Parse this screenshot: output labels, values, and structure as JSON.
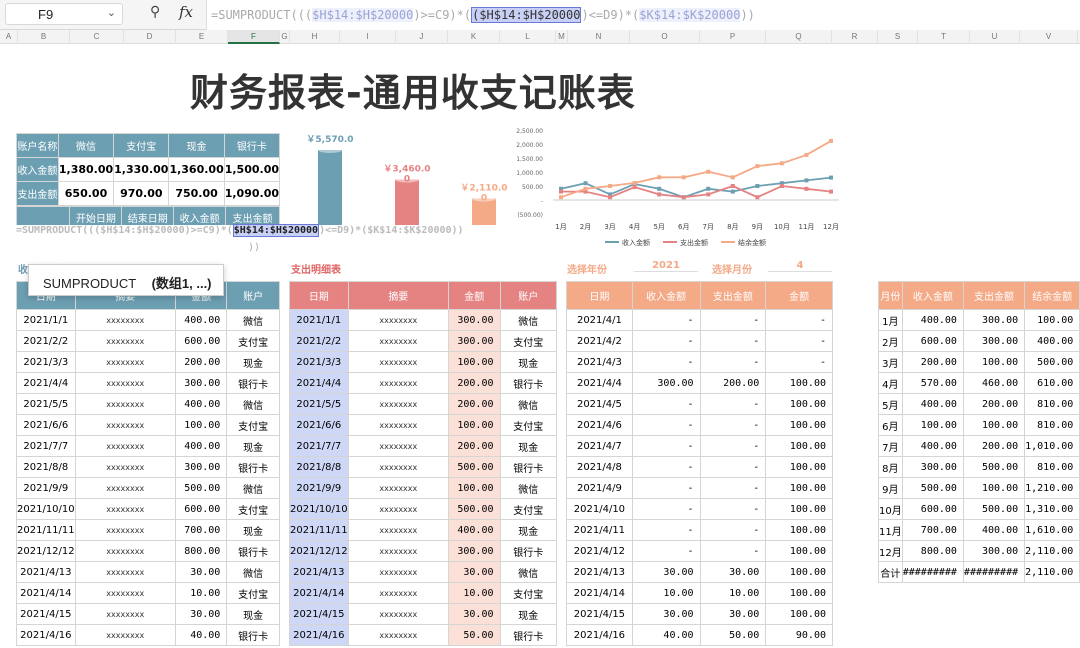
{
  "namebox": {
    "cell": "F9"
  },
  "formula_bar": {
    "parts": [
      {
        "t": "=SUMPRODUCT(((",
        "c": ""
      },
      {
        "t": "$H$14:$H$20000",
        "c": "ref"
      },
      {
        "t": ")>=C9)*(",
        "c": ""
      },
      {
        "t": "($H$14:$H$20000",
        "c": "refhi"
      },
      {
        "t": ")<=D9)*(",
        "c": ""
      },
      {
        "t": "$K$14:$K$20000",
        "c": "ref"
      },
      {
        "t": "))",
        "c": ""
      }
    ]
  },
  "columns": [
    "A",
    "B",
    "C",
    "D",
    "E",
    "F",
    "G",
    "H",
    "I",
    "J",
    "K",
    "L",
    "M",
    "N",
    "O",
    "P",
    "Q",
    "R",
    "S",
    "T",
    "U",
    "V"
  ],
  "title": "财务报表-通用收支记账表",
  "summary": {
    "headers": [
      "账户名称",
      "微信",
      "支付宝",
      "现金",
      "银行卡"
    ],
    "rows": [
      [
        "收入金额",
        "1,380.00",
        "1,330.00",
        "1,360.00",
        "1,500.00"
      ],
      [
        "支出金额",
        "650.00",
        "970.00",
        "750.00",
        "1,090.00"
      ]
    ],
    "query_headers": [
      "开始日期",
      "结束日期",
      "收入金额",
      "支出金额"
    ]
  },
  "cylinder": {
    "labels": [
      "￥5,570.0",
      "￥3,460.0",
      "￥2,110.0"
    ],
    "sublabels": [
      "",
      "0",
      "0"
    ],
    "values": [
      5570,
      3460,
      2110
    ],
    "colors": [
      "#6d9fb3",
      "#e58383",
      "#f4a987"
    ]
  },
  "chart_data": {
    "type": "line",
    "categories": [
      "1月",
      "2月",
      "3月",
      "4月",
      "5月",
      "6月",
      "7月",
      "8月",
      "9月",
      "10月",
      "11月",
      "12月"
    ],
    "ylim": [
      -500,
      2500
    ],
    "yticks": [
      "2,500.00",
      "2,000.00",
      "1,500.00",
      "1,000.00",
      "500.00",
      "-",
      "(500.00)"
    ],
    "series": [
      {
        "name": "收入金额",
        "color": "#6d9fb3",
        "values": [
          400,
          600,
          200,
          570,
          400,
          100,
          400,
          300,
          500,
          600,
          700,
          800
        ]
      },
      {
        "name": "支出金额",
        "color": "#e58383",
        "values": [
          300,
          300,
          100,
          460,
          200,
          100,
          200,
          500,
          100,
          500,
          400,
          300
        ]
      },
      {
        "name": "结余金额",
        "color": "#f4a987",
        "values": [
          100,
          400,
          500,
          610,
          810,
          810,
          1010,
          810,
          1210,
          1310,
          1610,
          2110
        ]
      }
    ]
  },
  "inline_formula": {
    "parts": [
      {
        "t": "=SUMPRODUCT(((",
        "c": ""
      },
      {
        "t": "$H$14:$H$20000",
        "c": ""
      },
      {
        "t": ")>=C9)*(",
        "c": ""
      },
      {
        "t": "$H$14:$H$20000",
        "c": "refhi"
      },
      {
        "t": ")<=D9)*(",
        "c": ""
      },
      {
        "t": "$K$14:$K$20000",
        "c": ""
      },
      {
        "t": "))",
        "c": ""
      }
    ],
    "line2": "))"
  },
  "tooltip": {
    "fn": "SUMPRODUCT",
    "args": "(数组1, ...)"
  },
  "labels": {
    "income_detail": "收入明细表",
    "expense_detail": "支出明细表",
    "select_year": "选择年份",
    "year": "2021",
    "select_month": "选择月份",
    "month": "4"
  },
  "income": {
    "headers": [
      "日期",
      "摘要",
      "金额",
      "账户"
    ],
    "rows": [
      [
        "2021/1/1",
        "xxxxxxxx",
        "400.00",
        "微信"
      ],
      [
        "2021/2/2",
        "xxxxxxxx",
        "600.00",
        "支付宝"
      ],
      [
        "2021/3/3",
        "xxxxxxxx",
        "200.00",
        "现金"
      ],
      [
        "2021/4/4",
        "xxxxxxxx",
        "300.00",
        "银行卡"
      ],
      [
        "2021/5/5",
        "xxxxxxxx",
        "400.00",
        "微信"
      ],
      [
        "2021/6/6",
        "xxxxxxxx",
        "100.00",
        "支付宝"
      ],
      [
        "2021/7/7",
        "xxxxxxxx",
        "400.00",
        "现金"
      ],
      [
        "2021/8/8",
        "xxxxxxxx",
        "300.00",
        "银行卡"
      ],
      [
        "2021/9/9",
        "xxxxxxxx",
        "500.00",
        "微信"
      ],
      [
        "2021/10/10",
        "xxxxxxxx",
        "600.00",
        "支付宝"
      ],
      [
        "2021/11/11",
        "xxxxxxxx",
        "700.00",
        "现金"
      ],
      [
        "2021/12/12",
        "xxxxxxxx",
        "800.00",
        "银行卡"
      ],
      [
        "2021/4/13",
        "xxxxxxxx",
        "30.00",
        "微信"
      ],
      [
        "2021/4/14",
        "xxxxxxxx",
        "10.00",
        "支付宝"
      ],
      [
        "2021/4/15",
        "xxxxxxxx",
        "30.00",
        "现金"
      ],
      [
        "2021/4/16",
        "xxxxxxxx",
        "40.00",
        "银行卡"
      ]
    ]
  },
  "expense": {
    "headers": [
      "日期",
      "摘要",
      "金额",
      "账户"
    ],
    "rows": [
      [
        "2021/1/1",
        "xxxxxxxx",
        "300.00",
        "微信"
      ],
      [
        "2021/2/2",
        "xxxxxxxx",
        "300.00",
        "支付宝"
      ],
      [
        "2021/3/3",
        "xxxxxxxx",
        "100.00",
        "现金"
      ],
      [
        "2021/4/4",
        "xxxxxxxx",
        "200.00",
        "银行卡"
      ],
      [
        "2021/5/5",
        "xxxxxxxx",
        "200.00",
        "微信"
      ],
      [
        "2021/6/6",
        "xxxxxxxx",
        "100.00",
        "支付宝"
      ],
      [
        "2021/7/7",
        "xxxxxxxx",
        "200.00",
        "现金"
      ],
      [
        "2021/8/8",
        "xxxxxxxx",
        "500.00",
        "银行卡"
      ],
      [
        "2021/9/9",
        "xxxxxxxx",
        "100.00",
        "微信"
      ],
      [
        "2021/10/10",
        "xxxxxxxx",
        "500.00",
        "支付宝"
      ],
      [
        "2021/11/11",
        "xxxxxxxx",
        "400.00",
        "现金"
      ],
      [
        "2021/12/12",
        "xxxxxxxx",
        "300.00",
        "银行卡"
      ],
      [
        "2021/4/13",
        "xxxxxxxx",
        "30.00",
        "微信"
      ],
      [
        "2021/4/14",
        "xxxxxxxx",
        "10.00",
        "支付宝"
      ],
      [
        "2021/4/15",
        "xxxxxxxx",
        "30.00",
        "现金"
      ],
      [
        "2021/4/16",
        "xxxxxxxx",
        "50.00",
        "银行卡"
      ]
    ]
  },
  "daily": {
    "headers": [
      "日期",
      "收入金额",
      "支出金额",
      "金额"
    ],
    "rows": [
      [
        "2021/4/1",
        "-",
        "-",
        "-"
      ],
      [
        "2021/4/2",
        "-",
        "-",
        "-"
      ],
      [
        "2021/4/3",
        "-",
        "-",
        "-"
      ],
      [
        "2021/4/4",
        "300.00",
        "200.00",
        "100.00"
      ],
      [
        "2021/4/5",
        "-",
        "-",
        "100.00"
      ],
      [
        "2021/4/6",
        "-",
        "-",
        "100.00"
      ],
      [
        "2021/4/7",
        "-",
        "-",
        "100.00"
      ],
      [
        "2021/4/8",
        "-",
        "-",
        "100.00"
      ],
      [
        "2021/4/9",
        "-",
        "-",
        "100.00"
      ],
      [
        "2021/4/10",
        "-",
        "-",
        "100.00"
      ],
      [
        "2021/4/11",
        "-",
        "-",
        "100.00"
      ],
      [
        "2021/4/12",
        "-",
        "-",
        "100.00"
      ],
      [
        "2021/4/13",
        "30.00",
        "30.00",
        "100.00"
      ],
      [
        "2021/4/14",
        "10.00",
        "10.00",
        "100.00"
      ],
      [
        "2021/4/15",
        "30.00",
        "30.00",
        "100.00"
      ],
      [
        "2021/4/16",
        "40.00",
        "50.00",
        "90.00"
      ]
    ]
  },
  "monthly": {
    "headers": [
      "月份",
      "收入金额",
      "支出金额",
      "结余金额"
    ],
    "rows": [
      [
        "1月",
        "400.00",
        "300.00",
        "100.00"
      ],
      [
        "2月",
        "600.00",
        "300.00",
        "400.00"
      ],
      [
        "3月",
        "200.00",
        "100.00",
        "500.00"
      ],
      [
        "4月",
        "570.00",
        "460.00",
        "610.00"
      ],
      [
        "5月",
        "400.00",
        "200.00",
        "810.00"
      ],
      [
        "6月",
        "100.00",
        "100.00",
        "810.00"
      ],
      [
        "7月",
        "400.00",
        "200.00",
        "1,010.00"
      ],
      [
        "8月",
        "300.00",
        "500.00",
        "810.00"
      ],
      [
        "9月",
        "500.00",
        "100.00",
        "1,210.00"
      ],
      [
        "10月",
        "600.00",
        "500.00",
        "1,310.00"
      ],
      [
        "11月",
        "700.00",
        "400.00",
        "1,610.00"
      ],
      [
        "12月",
        "800.00",
        "300.00",
        "2,110.00"
      ],
      [
        "合计",
        "#########",
        "#########",
        "2,110.00"
      ]
    ]
  }
}
